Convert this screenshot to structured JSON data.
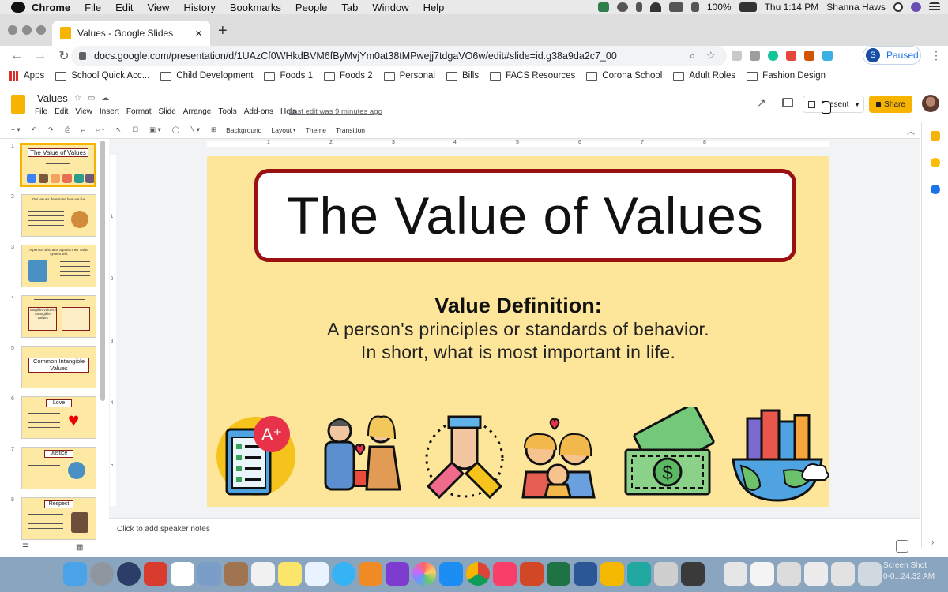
{
  "mac_menu": {
    "app": "Chrome",
    "items": [
      "File",
      "Edit",
      "View",
      "History",
      "Bookmarks",
      "People",
      "Tab",
      "Window",
      "Help"
    ],
    "battery": "100%",
    "clock": "Thu 1:14 PM",
    "user": "Shanna Haws"
  },
  "browser": {
    "tab_title": "Values - Google Slides",
    "url": "docs.google.com/presentation/d/1UAzCf0WHkdBVM6fByMvjYm0at38tMPwejj7tdgaVO6w/edit#slide=id.g38a9da2c7_00",
    "profile_initial": "S",
    "profile_status": "Paused",
    "bookmarks": [
      "Apps",
      "School Quick Acc...",
      "Child Development",
      "Foods 1",
      "Foods 2",
      "Personal",
      "Bills",
      "FACS Resources",
      "Corona School",
      "Adult Roles",
      "Fashion Design"
    ]
  },
  "slides_app": {
    "doc_title": "Values",
    "menus": [
      "File",
      "Edit",
      "View",
      "Insert",
      "Format",
      "Slide",
      "Arrange",
      "Tools",
      "Add-ons",
      "Help"
    ],
    "last_edit": "Last edit was 9 minutes ago",
    "present_label": "Present",
    "share_label": "Share",
    "toolbar": {
      "background": "Background",
      "layout": "Layout",
      "theme": "Theme",
      "transition": "Transition"
    },
    "ruler_marks": [
      "1",
      "2",
      "3",
      "4",
      "5",
      "6",
      "7",
      "8"
    ],
    "vruler_marks": [
      "1",
      "2",
      "3",
      "4",
      "5"
    ]
  },
  "filmstrip": [
    {
      "num": "1",
      "title": "The Value of Values",
      "selected": true
    },
    {
      "num": "2",
      "title": "Our values determine how we live"
    },
    {
      "num": "3",
      "title": "A person who acts against their value system will:"
    },
    {
      "num": "4",
      "title": "Tangible Values / Intangible Values"
    },
    {
      "num": "5",
      "title": "Common Intangible Values"
    },
    {
      "num": "6",
      "title": "Love"
    },
    {
      "num": "7",
      "title": "Justice"
    },
    {
      "num": "8",
      "title": "Respect"
    }
  ],
  "slide": {
    "title": "The Value of Values",
    "def_heading": "Value Definition:",
    "def_line1": "A person's principles or standards of behavior.",
    "def_line2": "In short, what is most important in life.",
    "icons": [
      "report-card-icon",
      "giving-flower-icon",
      "teamwork-hands-icon",
      "family-icon",
      "money-icon",
      "city-globe-icon"
    ]
  },
  "notes_placeholder": "Click to add speaker notes",
  "screenshot_label": "Screen Shot",
  "screenshot_time": "0-0...24.32 AM",
  "colors": {
    "accent": "#f6b400",
    "slide_bg": "#fde69a",
    "title_border": "#9b1010"
  }
}
